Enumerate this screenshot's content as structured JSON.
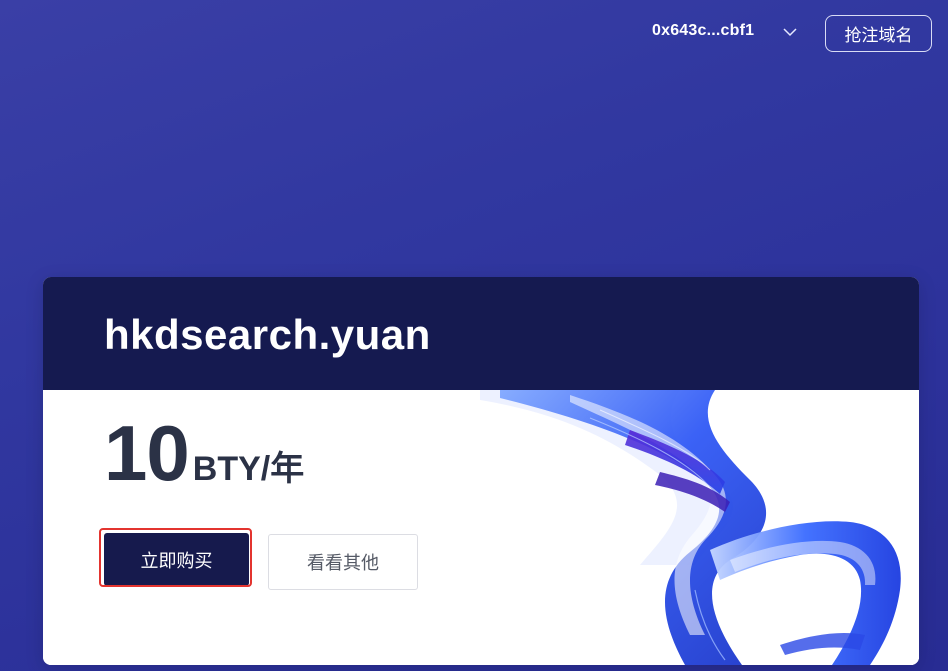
{
  "header": {
    "wallet_address": "0x643c...cbf1",
    "register_label": "抢注域名"
  },
  "card": {
    "domain": "hkdsearch.yuan",
    "price_amount": "10",
    "price_unit": "BTY/年",
    "buy_label": "立即购买",
    "other_label": "看看其他"
  },
  "colors": {
    "background": "#3138a0",
    "header_bg": "#151a50",
    "buy_button_bg": "#161a4d",
    "accent_blue": "#2c5cff",
    "focus_ring": "#e3342f"
  },
  "icons": {
    "wallet_dropdown": "chevron-down-icon"
  }
}
